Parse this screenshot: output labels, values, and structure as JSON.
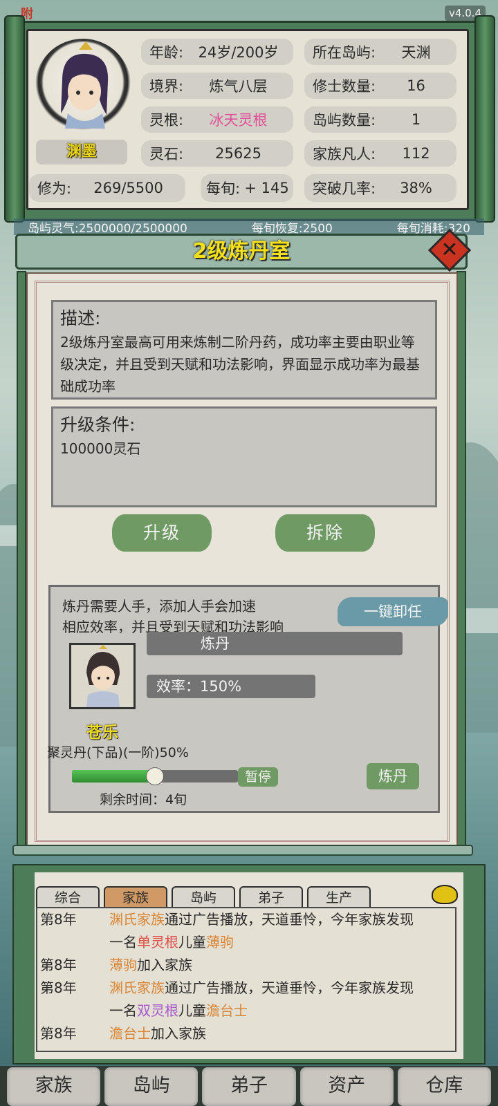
{
  "app": {
    "version": "v4.0.4",
    "logo_text": "附"
  },
  "player": {
    "name": "渊墨",
    "age_label": "年龄:",
    "age_value": "24岁/200岁",
    "realm_label": "境界:",
    "realm_value": "炼气八层",
    "root_label": "灵根:",
    "root_value": "冰天灵根",
    "stone_label": "灵石:",
    "stone_value": "25625",
    "cultivation_label": "修为:",
    "cultivation_value": "269/5500",
    "per_turn_label": "每旬:",
    "per_turn_value": "+ 145"
  },
  "island": {
    "island_label": "所在岛屿:",
    "island_value": "天渊",
    "cultivators_label": "修士数量:",
    "cultivators_value": "16",
    "islands_label": "岛屿数量:",
    "islands_value": "1",
    "mortals_label": "家族凡人:",
    "mortals_value": "112",
    "breakthrough_label": "突破几率:",
    "breakthrough_value": "38%"
  },
  "resources": {
    "qi": "岛屿灵气:2500000/2500000",
    "recovery": "每旬恢复:2500",
    "consumption": "每旬消耗:320"
  },
  "dialog": {
    "title": "2级炼丹室",
    "close_symbol": "✕",
    "desc_title": "描述:",
    "desc_text": "2级炼丹室最高可用来炼制二阶丹药，成功率主要由职业等级决定，并且受到天赋和功法影响，界面显示成功率为最基础成功率",
    "upgrade_title": "升级条件:",
    "upgrade_text": "100000灵石",
    "upgrade_btn": "升级",
    "demolish_btn": "拆除",
    "work_text_1": "炼丹需要人手，添加人手会加速",
    "work_text_2": "相应效率，并且受到天赋和功法影响",
    "unassign_btn": "一键卸任",
    "job_label": "炼丹",
    "efficiency_label": "效率：150%",
    "worker_name": "苍乐",
    "recipe": "聚灵丹(下品)(一阶)50%",
    "progress": 0.5,
    "pause_btn": "暂停",
    "craft_btn": "炼丹",
    "remaining": "剩余时间：4旬"
  },
  "log_tabs": [
    "综合",
    "家族",
    "岛屿",
    "弟子",
    "生产"
  ],
  "log_active_tab": 1,
  "log": [
    {
      "year": "第8年",
      "parts": [
        [
          "渊氏家族",
          "orange"
        ],
        [
          "通过广告播放，天道垂怜，今年家族发现",
          ""
        ]
      ]
    },
    {
      "year": "",
      "parts": [
        [
          "一名",
          ""
        ],
        [
          "单灵根",
          "red"
        ],
        [
          "儿童",
          ""
        ],
        [
          "薄驹",
          "orange"
        ]
      ]
    },
    {
      "year": "第8年",
      "parts": [
        [
          "薄驹",
          "orange"
        ],
        [
          "加入家族",
          ""
        ]
      ]
    },
    {
      "year": "第8年",
      "parts": [
        [
          "渊氏家族",
          "orange"
        ],
        [
          "通过广告播放，天道垂怜，今年家族发现",
          ""
        ]
      ]
    },
    {
      "year": "",
      "parts": [
        [
          "一名",
          ""
        ],
        [
          "双灵根",
          "purple"
        ],
        [
          "儿童",
          ""
        ],
        [
          "澹台士",
          "orange"
        ]
      ]
    },
    {
      "year": "第8年",
      "parts": [
        [
          "澹台士",
          "orange"
        ],
        [
          "加入家族",
          ""
        ]
      ]
    }
  ],
  "nav": [
    "家族",
    "岛屿",
    "弟子",
    "资产",
    "仓库"
  ],
  "colors": {
    "accent_yellow": "#f4e11a",
    "root_pink": "#e0509a",
    "button_green": "#6f9a64"
  }
}
